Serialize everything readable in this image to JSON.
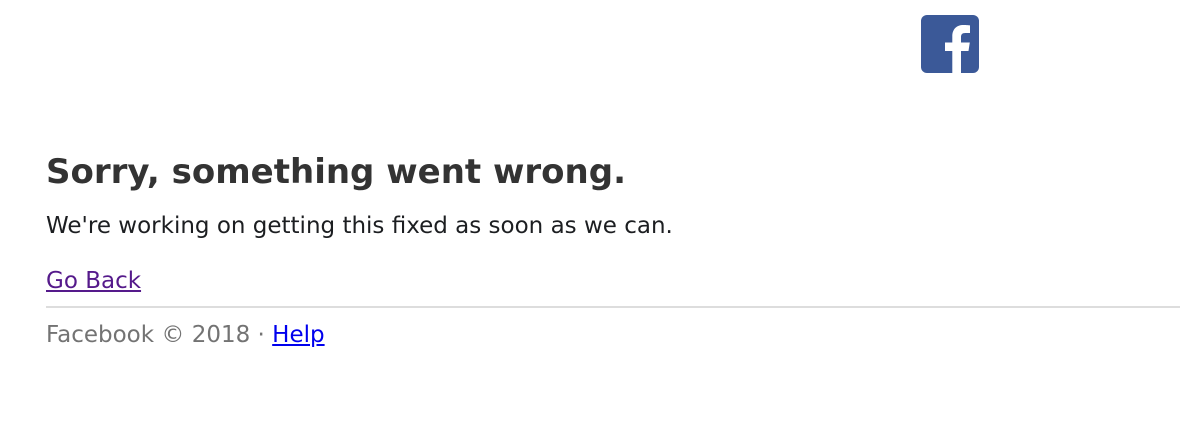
{
  "header": {
    "logo_icon": "facebook-logo-icon",
    "logo_color": "#3b5998"
  },
  "error": {
    "title": "Sorry, something went wrong.",
    "message": "We're working on getting this fixed as soon as we can.",
    "back_label": "Go Back"
  },
  "footer": {
    "copyright": "Facebook © 2018",
    "separator": " · ",
    "help_label": "Help"
  },
  "colors": {
    "visited_link": "#551a8b",
    "link": "#0000ee",
    "muted_text": "#737373",
    "divider": "#dddddd"
  }
}
